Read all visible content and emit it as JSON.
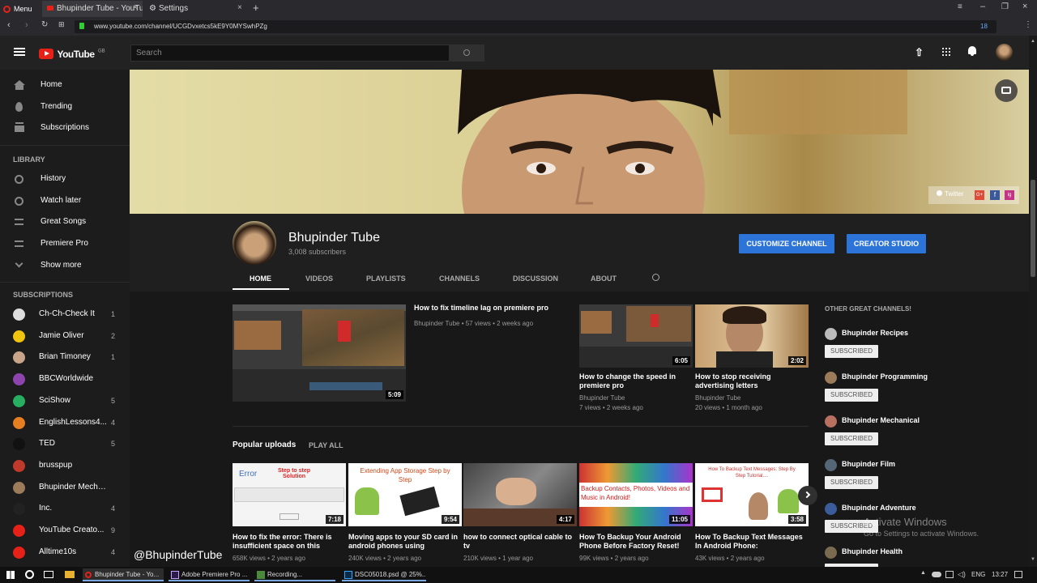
{
  "browser": {
    "menu_label": "Menu",
    "tabs": [
      {
        "label": "Bhupinder Tube - YouTube"
      },
      {
        "label": "Settings"
      }
    ],
    "url": "www.youtube.com/channel/UCGDvxetcs5kE9Y0MYSwhPZg",
    "badge_count": "18"
  },
  "header": {
    "logo_text": "YouTube",
    "region": "GB",
    "search_placeholder": "Search"
  },
  "sidebar": {
    "main": [
      {
        "label": "Home",
        "icon": "home-icon"
      },
      {
        "label": "Trending",
        "icon": "flame-icon"
      },
      {
        "label": "Subscriptions",
        "icon": "subscriptions-icon"
      }
    ],
    "library_title": "LIBRARY",
    "library": [
      {
        "label": "History",
        "icon": "history-icon"
      },
      {
        "label": "Watch later",
        "icon": "clock-icon"
      },
      {
        "label": "Great Songs",
        "icon": "playlist-icon"
      },
      {
        "label": "Premiere Pro",
        "icon": "playlist-icon"
      },
      {
        "label": "Show more",
        "icon": "chevron-down-icon"
      }
    ],
    "subs_title": "SUBSCRIPTIONS",
    "subscriptions": [
      {
        "label": "Ch-Ch-Check It",
        "count": "1",
        "color": "#dddddd"
      },
      {
        "label": "Jamie Oliver",
        "count": "2",
        "color": "#f1c40f"
      },
      {
        "label": "Brian Timoney",
        "count": "1",
        "color": "#c8a58a"
      },
      {
        "label": "BBCWorldwide",
        "count": "",
        "color": "#8e44ad"
      },
      {
        "label": "SciShow",
        "count": "5",
        "color": "#27ae60"
      },
      {
        "label": "EnglishLessons4...",
        "count": "4",
        "color": "#e67e22"
      },
      {
        "label": "TED",
        "count": "5",
        "color": "#111111"
      },
      {
        "label": "brusspup",
        "count": "",
        "color": "#c0392b"
      },
      {
        "label": "Bhupinder Mecha...",
        "count": "",
        "color": "#9b7b5a"
      },
      {
        "label": "Inc.",
        "count": "4",
        "color": "#222222"
      },
      {
        "label": "YouTube Creato...",
        "count": "9",
        "color": "#e62117"
      },
      {
        "label": "Alltime10s",
        "count": "4",
        "color": "#e62117"
      }
    ]
  },
  "banner": {
    "links": [
      "Twitter",
      "G+",
      "f",
      "ig"
    ]
  },
  "channel": {
    "name": "Bhupinder Tube",
    "subscribers": "3,008 subscribers",
    "customize_label": "CUSTOMIZE CHANNEL",
    "studio_label": "CREATOR STUDIO",
    "tabs": [
      "HOME",
      "VIDEOS",
      "PLAYLISTS",
      "CHANNELS",
      "DISCUSSION",
      "ABOUT"
    ]
  },
  "featured": {
    "title": "How to fix timeline lag on premiere pro",
    "meta": "Bhupinder Tube • 57 views • 2 weeks ago",
    "duration": "5:09"
  },
  "side_videos": [
    {
      "title": "How to change the speed in premiere pro",
      "channel": "Bhupinder Tube",
      "meta": "7 views • 2 weeks ago",
      "duration": "6:05"
    },
    {
      "title": "How to stop receiving advertising letters",
      "channel": "Bhupinder Tube",
      "meta": "20 views • 1 month ago",
      "duration": "2:02"
    }
  ],
  "popular": {
    "title": "Popular uploads",
    "play_all": "PLAY ALL",
    "videos": [
      {
        "title": "How to fix the error: There is insufficient space on this",
        "meta": "658K views • 2 years ago",
        "duration": "7:18",
        "thumb_text": "Error",
        "thumb_text2": "Step to step Solution"
      },
      {
        "title": "Moving apps to your SD card in android phones using",
        "meta": "240K views • 2 years ago",
        "duration": "9:54",
        "thumb_text": "Extending App Storage Step by Step"
      },
      {
        "title": "how to connect optical cable to tv",
        "meta": "210K views • 1 year ago",
        "duration": "4:17"
      },
      {
        "title": "How To Backup Your Android Phone Before Factory Reset!",
        "meta": "99K views • 2 years ago",
        "duration": "11:05",
        "thumb_text": "Backup Contacts, Photos, Videos and Music in Android!"
      },
      {
        "title": "How To Backup Text Messages In Android Phone:",
        "meta": "43K views • 2 years ago",
        "duration": "3:58",
        "thumb_text": "How To Backup Text Messages: Step By Step Tutorial...."
      }
    ]
  },
  "other_channels": {
    "title": "OTHER GREAT CHANNELS!",
    "subscribed_label": "SUBSCRIBED",
    "items": [
      {
        "name": "Bhupinder Recipes",
        "color": "#bbbbbb"
      },
      {
        "name": "Bhupinder Programming",
        "color": "#9b7b5a"
      },
      {
        "name": "Bhupinder Mechanical",
        "color": "#b87060"
      },
      {
        "name": "Bhupinder Film",
        "color": "#556677"
      },
      {
        "name": "Bhupinder Adventure",
        "color": "#3b5b9b"
      },
      {
        "name": "Bhupinder Health",
        "color": "#7a6a50"
      }
    ]
  },
  "watermark": "@BhupinderTube",
  "activation": {
    "line1": "Activate Windows",
    "line2": "Go to Settings to activate Windows."
  },
  "taskbar": {
    "items": [
      "Bhupinder Tube - Yo...",
      "Adobe Premiere Pro ...",
      "Recording...",
      "DSC05018.psd @ 25%..."
    ],
    "lang": "ENG",
    "time": "13:27"
  },
  "colors": {
    "accent_blue": "#2d74d8",
    "youtube_red": "#e62117",
    "background": "#181818"
  }
}
